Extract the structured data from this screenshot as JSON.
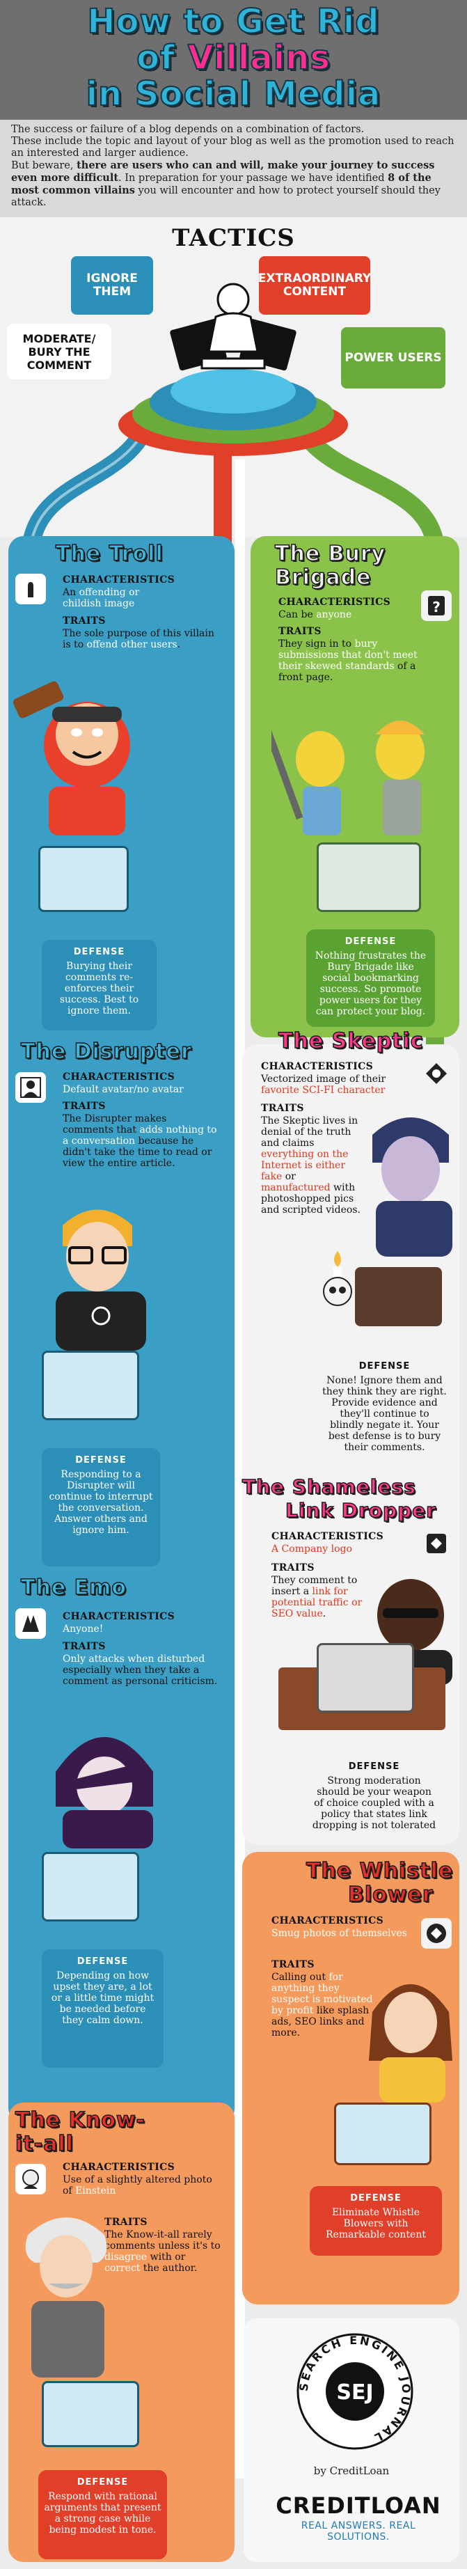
{
  "header": {
    "title_line1": "How to Get Rid",
    "title_line2_pre": "of ",
    "title_line2_hl": "Villains",
    "title_line3": "in Social Media"
  },
  "intro": {
    "p1": "The success or failure of a blog depends on a combination of factors.",
    "p2": "These include the topic and layout of your blog as well as the promotion used to reach an interested and larger audience.",
    "p3_pre": "But beware, ",
    "p3_bold1": "there are users who can and will, make your journey to success even more difficult",
    "p3_mid": ". In preparation for your passage we have identified ",
    "p3_bold2": "8 of the most common villains",
    "p3_post": " you will encounter and how to protect yourself should they attack."
  },
  "tactics": {
    "heading": "TACTICS",
    "ignore": "IGNORE THEM",
    "extraordinary": "EXTRAORDINARY CONTENT",
    "moderate": "MODERATE/ BURY THE COMMENT",
    "power": "POWER USERS"
  },
  "labels": {
    "characteristics": "CHARACTERISTICS",
    "traits": "TRAITS",
    "defense": "DEFENSE"
  },
  "villains": {
    "troll": {
      "title": "The Troll",
      "char_pre": "An ",
      "char_hl": "offending or childish image",
      "traits_pre": "The sole purpose of this villain is to ",
      "traits_hl": "offend other users",
      "traits_post": ".",
      "defense": "Burying their comments re-enforces their success. Best to ignore them."
    },
    "bury": {
      "title_1": "The Bury",
      "title_2": "Brigade",
      "char_pre": "Can be ",
      "char_hl": "anyone",
      "traits_pre": "They sign in to ",
      "traits_hl": "bury submissions that don't meet their skewed standards",
      "traits_post": " of a front page.",
      "defense": "Nothing frustrates the Bury Brigade like social bookmarking success. So promote power users for they can protect your blog."
    },
    "disrupter": {
      "title": "The Disrupter",
      "char": "Default avatar/no avatar",
      "traits_pre": "The Disrupter makes comments that ",
      "traits_hl": "adds nothing to a conversation",
      "traits_post": " because he didn't take the time to read or view the entire article.",
      "defense": "Responding to a Disrupter will continue to interrupt the conversation. Answer others and ignore him."
    },
    "skeptic": {
      "title": "The Skeptic",
      "char_pre": "Vectorized image of their ",
      "char_hl": "favorite SCI-FI character",
      "traits_pre": "The Skeptic lives in denial of the truth and claims ",
      "traits_hl1": "everything on the Internet is either fake",
      "traits_mid": " or ",
      "traits_hl2": "manufactured",
      "traits_post": " with photoshopped pics and scripted videos.",
      "defense": "None! Ignore them and they think they are right. Provide evidence and they'll continue to blindly negate it. Your best defense is to bury their comments."
    },
    "emo": {
      "title": "The Emo",
      "char": "Anyone!",
      "traits_hl": "Only attacks when disturbed",
      "traits_post": " especially when they take a comment as personal criticism.",
      "defense": "Depending on how upset they are, a lot or a little time might be needed before they calm down."
    },
    "link": {
      "title_1": "The Shameless",
      "title_2": "Link Dropper",
      "char": "A Company logo",
      "traits_pre": "They comment to insert a ",
      "traits_hl": "link for potential traffic or SEO value",
      "traits_post": ".",
      "defense": "Strong moderation should be your weapon of choice coupled with a policy that states link dropping is not tolerated"
    },
    "whistle": {
      "title_1": "The Whistle",
      "title_2": "Blower",
      "char": "Smug photos of themselves",
      "traits_pre": "Calling out ",
      "traits_hl": "for anything they suspect is motivated by profit",
      "traits_post": " like splash ads, SEO links and more.",
      "defense": "Eliminate Whistle Blowers with Remarkable content"
    },
    "knowall": {
      "title_1": "The Know-",
      "title_2": "it-all",
      "char_pre": "Use of a slightly altered photo of ",
      "char_hl": "Einstein",
      "traits_pre": "The Know-it-all rarely comments unless it's to ",
      "traits_hl1": "disagree",
      "traits_mid": " with or ",
      "traits_hl2": "correct",
      "traits_post": " the author.",
      "defense": "Respond with rational arguments that present a strong case while being modest in tone."
    }
  },
  "footer": {
    "sej_ring": "SEARCH ENGINE JOURNAL",
    "sej_mark": "SEJ",
    "by": "by CreditLoan",
    "brand": "CREDITLOAN",
    "tagline": "REAL ANSWERS. REAL SOLUTIONS."
  },
  "colors": {
    "blue": "#2b8fb8",
    "green": "#6bab3c",
    "red": "#e0402a",
    "orange": "#f08a4b",
    "grey": "#6f6f6f"
  }
}
